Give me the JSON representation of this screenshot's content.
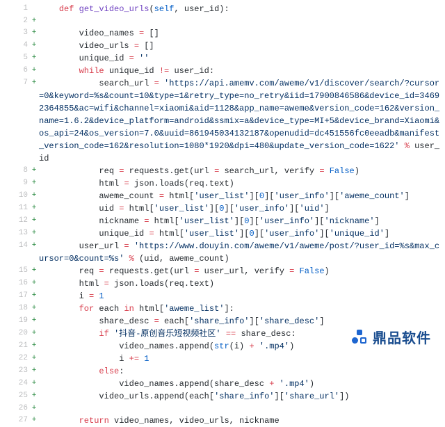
{
  "watermark": {
    "text": "鼎品软件"
  },
  "lines": [
    {
      "n": 1,
      "m": "",
      "indent": 1,
      "tokens": [
        [
          "kw",
          "def "
        ],
        [
          "fn",
          "get_video_urls"
        ],
        [
          "nm",
          "("
        ],
        [
          "c",
          "self"
        ],
        [
          "nm",
          ", user_id):"
        ]
      ]
    },
    {
      "n": 2,
      "m": "+",
      "indent": 0,
      "tokens": []
    },
    {
      "n": 3,
      "m": "+",
      "indent": 2,
      "tokens": [
        [
          "nm",
          "video_names "
        ],
        [
          "op",
          "="
        ],
        [
          "nm",
          " []"
        ]
      ]
    },
    {
      "n": 4,
      "m": "+",
      "indent": 2,
      "tokens": [
        [
          "nm",
          "video_urls "
        ],
        [
          "op",
          "="
        ],
        [
          "nm",
          " []"
        ]
      ]
    },
    {
      "n": 5,
      "m": "+",
      "indent": 2,
      "tokens": [
        [
          "nm",
          "unique_id "
        ],
        [
          "op",
          "="
        ],
        [
          "nm",
          " "
        ],
        [
          "s",
          "''"
        ]
      ]
    },
    {
      "n": 6,
      "m": "+",
      "indent": 2,
      "tokens": [
        [
          "kw",
          "while"
        ],
        [
          "nm",
          " unique_id "
        ],
        [
          "op",
          "!="
        ],
        [
          "nm",
          " user_id:"
        ]
      ]
    },
    {
      "n": 7,
      "m": "+",
      "indent": 3,
      "tokens": [
        [
          "nm",
          "search_url "
        ],
        [
          "op",
          "="
        ],
        [
          "nm",
          " "
        ],
        [
          "s",
          "'https://api.amemv.com/aweme/v1/discover/search/?cursor=0&keyword=%s&count=10&type=1&retry_type=no_retry&iid=17900846586&device_id=34692364855&ac=wifi&channel=xiaomi&aid=1128&app_name=aweme&version_code=162&version_name=1.6.2&device_platform=android&ssmix=a&device_type=MI+5&device_brand=Xiaomi&os_api=24&os_version=7.0&uuid=861945034132187&openudid=dc451556fc0eeadb&manifest_version_code=162&resolution=1080*1920&dpi=480&update_version_code=1622'"
        ],
        [
          "nm",
          " "
        ],
        [
          "op",
          "%"
        ],
        [
          "nm",
          " user_id"
        ]
      ]
    },
    {
      "n": 8,
      "m": "+",
      "indent": 3,
      "tokens": [
        [
          "nm",
          "req "
        ],
        [
          "op",
          "="
        ],
        [
          "nm",
          " requests.get("
        ],
        [
          "nm",
          "url"
        ],
        [
          "nm",
          " "
        ],
        [
          "op",
          "="
        ],
        [
          "nm",
          " search_url, "
        ],
        [
          "nm",
          "verify"
        ],
        [
          "nm",
          " "
        ],
        [
          "op",
          "="
        ],
        [
          "nm",
          " "
        ],
        [
          "c",
          "False"
        ],
        [
          "nm",
          ")"
        ]
      ]
    },
    {
      "n": 9,
      "m": "+",
      "indent": 3,
      "tokens": [
        [
          "nm",
          "html "
        ],
        [
          "op",
          "="
        ],
        [
          "nm",
          " json.loads(req.text)"
        ]
      ]
    },
    {
      "n": 10,
      "m": "+",
      "indent": 3,
      "tokens": [
        [
          "nm",
          "aweme_count "
        ],
        [
          "op",
          "="
        ],
        [
          "nm",
          " html["
        ],
        [
          "s",
          "'user_list'"
        ],
        [
          "nm",
          "]["
        ],
        [
          "c",
          "0"
        ],
        [
          "nm",
          "]["
        ],
        [
          "s",
          "'user_info'"
        ],
        [
          "nm",
          "]["
        ],
        [
          "s",
          "'aweme_count'"
        ],
        [
          "nm",
          "]"
        ]
      ]
    },
    {
      "n": 11,
      "m": "+",
      "indent": 3,
      "tokens": [
        [
          "nm",
          "uid "
        ],
        [
          "op",
          "="
        ],
        [
          "nm",
          " html["
        ],
        [
          "s",
          "'user_list'"
        ],
        [
          "nm",
          "]["
        ],
        [
          "c",
          "0"
        ],
        [
          "nm",
          "]["
        ],
        [
          "s",
          "'user_info'"
        ],
        [
          "nm",
          "]["
        ],
        [
          "s",
          "'uid'"
        ],
        [
          "nm",
          "]"
        ]
      ]
    },
    {
      "n": 12,
      "m": "+",
      "indent": 3,
      "tokens": [
        [
          "nm",
          "nickname "
        ],
        [
          "op",
          "="
        ],
        [
          "nm",
          " html["
        ],
        [
          "s",
          "'user_list'"
        ],
        [
          "nm",
          "]["
        ],
        [
          "c",
          "0"
        ],
        [
          "nm",
          "]["
        ],
        [
          "s",
          "'user_info'"
        ],
        [
          "nm",
          "]["
        ],
        [
          "s",
          "'nickname'"
        ],
        [
          "nm",
          "]"
        ]
      ]
    },
    {
      "n": 13,
      "m": "+",
      "indent": 3,
      "tokens": [
        [
          "nm",
          "unique_id "
        ],
        [
          "op",
          "="
        ],
        [
          "nm",
          " html["
        ],
        [
          "s",
          "'user_list'"
        ],
        [
          "nm",
          "]["
        ],
        [
          "c",
          "0"
        ],
        [
          "nm",
          "]["
        ],
        [
          "s",
          "'user_info'"
        ],
        [
          "nm",
          "]["
        ],
        [
          "s",
          "'unique_id'"
        ],
        [
          "nm",
          "]"
        ]
      ]
    },
    {
      "n": 14,
      "m": "+",
      "indent": 2,
      "tokens": [
        [
          "nm",
          "user_url "
        ],
        [
          "op",
          "="
        ],
        [
          "nm",
          " "
        ],
        [
          "s",
          "'https://www.douyin.com/aweme/v1/aweme/post/?user_id=%s&max_cursor=0&count=%s'"
        ],
        [
          "nm",
          " "
        ],
        [
          "op",
          "%"
        ],
        [
          "nm",
          " (uid, aweme_count)"
        ]
      ]
    },
    {
      "n": 15,
      "m": "+",
      "indent": 2,
      "tokens": [
        [
          "nm",
          "req "
        ],
        [
          "op",
          "="
        ],
        [
          "nm",
          " requests.get("
        ],
        [
          "nm",
          "url"
        ],
        [
          "nm",
          " "
        ],
        [
          "op",
          "="
        ],
        [
          "nm",
          " user_url, "
        ],
        [
          "nm",
          "verify"
        ],
        [
          "nm",
          " "
        ],
        [
          "op",
          "="
        ],
        [
          "nm",
          " "
        ],
        [
          "c",
          "False"
        ],
        [
          "nm",
          ")"
        ]
      ]
    },
    {
      "n": 16,
      "m": "+",
      "indent": 2,
      "tokens": [
        [
          "nm",
          "html "
        ],
        [
          "op",
          "="
        ],
        [
          "nm",
          " json.loads(req.text)"
        ]
      ]
    },
    {
      "n": 17,
      "m": "+",
      "indent": 2,
      "tokens": [
        [
          "nm",
          "i "
        ],
        [
          "op",
          "="
        ],
        [
          "nm",
          " "
        ],
        [
          "c",
          "1"
        ]
      ]
    },
    {
      "n": 18,
      "m": "+",
      "indent": 2,
      "tokens": [
        [
          "kw",
          "for"
        ],
        [
          "nm",
          " each "
        ],
        [
          "kw",
          "in"
        ],
        [
          "nm",
          " html["
        ],
        [
          "s",
          "'aweme_list'"
        ],
        [
          "nm",
          "]:"
        ]
      ]
    },
    {
      "n": 19,
      "m": "+",
      "indent": 3,
      "tokens": [
        [
          "nm",
          "share_desc "
        ],
        [
          "op",
          "="
        ],
        [
          "nm",
          " each["
        ],
        [
          "s",
          "'share_info'"
        ],
        [
          "nm",
          "]["
        ],
        [
          "s",
          "'share_desc'"
        ],
        [
          "nm",
          "]"
        ]
      ]
    },
    {
      "n": 20,
      "m": "+",
      "indent": 3,
      "tokens": [
        [
          "kw",
          "if"
        ],
        [
          "nm",
          " "
        ],
        [
          "s",
          "'抖音-原创音乐短视频社区'"
        ],
        [
          "nm",
          " "
        ],
        [
          "op",
          "=="
        ],
        [
          "nm",
          " share_desc:"
        ]
      ]
    },
    {
      "n": 21,
      "m": "+",
      "indent": 4,
      "tokens": [
        [
          "nm",
          "video_names.append("
        ],
        [
          "c",
          "str"
        ],
        [
          "nm",
          "(i) "
        ],
        [
          "op",
          "+"
        ],
        [
          "nm",
          " "
        ],
        [
          "s",
          "'.mp4'"
        ],
        [
          "nm",
          ")"
        ]
      ]
    },
    {
      "n": 22,
      "m": "+",
      "indent": 4,
      "tokens": [
        [
          "nm",
          "i "
        ],
        [
          "op",
          "+="
        ],
        [
          "nm",
          " "
        ],
        [
          "c",
          "1"
        ]
      ]
    },
    {
      "n": 23,
      "m": "+",
      "indent": 3,
      "tokens": [
        [
          "kw",
          "else"
        ],
        [
          "nm",
          ":"
        ]
      ]
    },
    {
      "n": 24,
      "m": "+",
      "indent": 4,
      "tokens": [
        [
          "nm",
          "video_names.append(share_desc "
        ],
        [
          "op",
          "+"
        ],
        [
          "nm",
          " "
        ],
        [
          "s",
          "'.mp4'"
        ],
        [
          "nm",
          ")"
        ]
      ]
    },
    {
      "n": 25,
      "m": "+",
      "indent": 3,
      "tokens": [
        [
          "nm",
          "video_urls.append(each["
        ],
        [
          "s",
          "'share_info'"
        ],
        [
          "nm",
          "]["
        ],
        [
          "s",
          "'share_url'"
        ],
        [
          "nm",
          "])"
        ]
      ]
    },
    {
      "n": 26,
      "m": "+",
      "indent": 0,
      "tokens": []
    },
    {
      "n": 27,
      "m": "+",
      "indent": 2,
      "tokens": [
        [
          "kw",
          "return"
        ],
        [
          "nm",
          " video_names, video_urls, nickname"
        ]
      ]
    }
  ]
}
